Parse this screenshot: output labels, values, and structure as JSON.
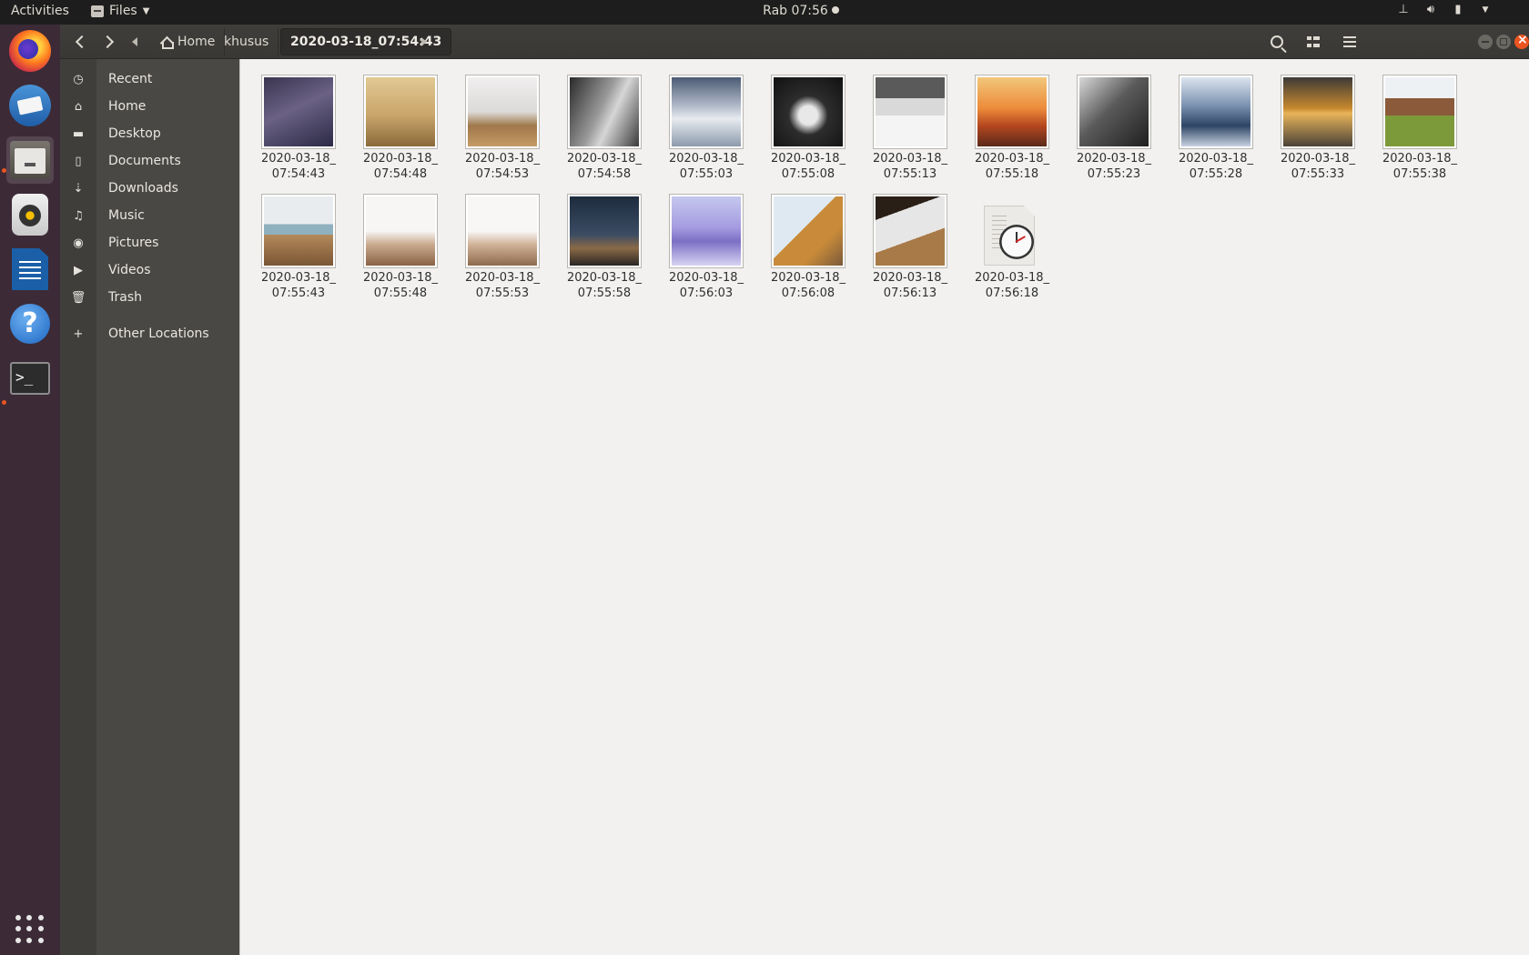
{
  "topbar": {
    "activities": "Activities",
    "app_menu": "Files",
    "clock": "Rab 07:56"
  },
  "dock": {
    "items": [
      "firefox-icon",
      "thunderbird-icon",
      "files-icon",
      "rhythmbox-icon",
      "libreoffice-writer-icon",
      "help-icon",
      "terminal-icon",
      "show-applications-icon"
    ]
  },
  "headerbar": {
    "breadcrumbs": [
      "Home",
      "khusus",
      "2020-03-18_07:54:43"
    ]
  },
  "sidebar": {
    "items": [
      {
        "label": "Recent",
        "icon": "clock-icon"
      },
      {
        "label": "Home",
        "icon": "home-icon"
      },
      {
        "label": "Desktop",
        "icon": "folder-icon"
      },
      {
        "label": "Documents",
        "icon": "document-icon"
      },
      {
        "label": "Downloads",
        "icon": "download-icon"
      },
      {
        "label": "Music",
        "icon": "music-icon"
      },
      {
        "label": "Pictures",
        "icon": "camera-icon"
      },
      {
        "label": "Videos",
        "icon": "video-icon"
      },
      {
        "label": "Trash",
        "icon": "trash-icon"
      },
      {
        "label": "Other Locations",
        "icon": "plus-icon"
      }
    ]
  },
  "files": [
    {
      "line1": "2020-03-18_",
      "line2": "07:54:43"
    },
    {
      "line1": "2020-03-18_",
      "line2": "07:54:48"
    },
    {
      "line1": "2020-03-18_",
      "line2": "07:54:53"
    },
    {
      "line1": "2020-03-18_",
      "line2": "07:54:58"
    },
    {
      "line1": "2020-03-18_",
      "line2": "07:55:03"
    },
    {
      "line1": "2020-03-18_",
      "line2": "07:55:08"
    },
    {
      "line1": "2020-03-18_",
      "line2": "07:55:13"
    },
    {
      "line1": "2020-03-18_",
      "line2": "07:55:18"
    },
    {
      "line1": "2020-03-18_",
      "line2": "07:55:23"
    },
    {
      "line1": "2020-03-18_",
      "line2": "07:55:28"
    },
    {
      "line1": "2020-03-18_",
      "line2": "07:55:33"
    },
    {
      "line1": "2020-03-18_",
      "line2": "07:55:38"
    },
    {
      "line1": "2020-03-18_",
      "line2": "07:55:43"
    },
    {
      "line1": "2020-03-18_",
      "line2": "07:55:48"
    },
    {
      "line1": "2020-03-18_",
      "line2": "07:55:53"
    },
    {
      "line1": "2020-03-18_",
      "line2": "07:55:58"
    },
    {
      "line1": "2020-03-18_",
      "line2": "07:56:03"
    },
    {
      "line1": "2020-03-18_",
      "line2": "07:56:08"
    },
    {
      "line1": "2020-03-18_",
      "line2": "07:56:13"
    },
    {
      "line1": "2020-03-18_",
      "line2": "07:56:18"
    }
  ],
  "colors": {
    "accent": "#e95420",
    "dock": "#3c2a36",
    "sidebar": "#4a4845",
    "content": "#f2f1f0"
  }
}
